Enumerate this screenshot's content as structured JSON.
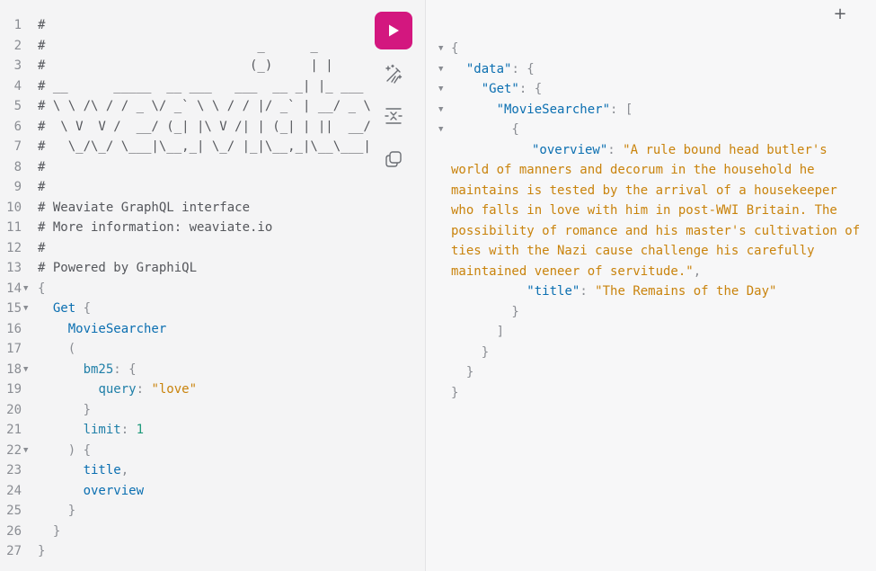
{
  "query_editor": {
    "lines": [
      {
        "n": "1",
        "fold": "",
        "parts": [
          {
            "t": "#",
            "c": "c-comment"
          }
        ]
      },
      {
        "n": "2",
        "fold": "",
        "parts": [
          {
            "t": "#                            _      _",
            "c": "c-comment"
          }
        ]
      },
      {
        "n": "3",
        "fold": "",
        "parts": [
          {
            "t": "#                           (_)     | |",
            "c": "c-comment"
          }
        ]
      },
      {
        "n": "4",
        "fold": "",
        "parts": [
          {
            "t": "# __      _____  __ ___   ___  __ _| |_ ___",
            "c": "c-comment"
          }
        ]
      },
      {
        "n": "5",
        "fold": "",
        "parts": [
          {
            "t": "# \\ \\ /\\ / / _ \\/ _` \\ \\ / / |/ _` | __/ _ \\",
            "c": "c-comment"
          }
        ]
      },
      {
        "n": "6",
        "fold": "",
        "parts": [
          {
            "t": "#  \\ V  V /  __/ (_| |\\ V /| | (_| | ||  __/",
            "c": "c-comment"
          }
        ]
      },
      {
        "n": "7",
        "fold": "",
        "parts": [
          {
            "t": "#   \\_/\\_/ \\___|\\__,_| \\_/ |_|\\__,_|\\__\\___|",
            "c": "c-comment"
          }
        ]
      },
      {
        "n": "8",
        "fold": "",
        "parts": [
          {
            "t": "#",
            "c": "c-comment"
          }
        ]
      },
      {
        "n": "9",
        "fold": "",
        "parts": [
          {
            "t": "#",
            "c": "c-comment"
          }
        ]
      },
      {
        "n": "10",
        "fold": "",
        "parts": [
          {
            "t": "# Weaviate GraphQL interface",
            "c": "c-comment"
          }
        ]
      },
      {
        "n": "11",
        "fold": "",
        "parts": [
          {
            "t": "# More information: weaviate.io",
            "c": "c-comment"
          }
        ]
      },
      {
        "n": "12",
        "fold": "",
        "parts": [
          {
            "t": "#",
            "c": "c-comment"
          }
        ]
      },
      {
        "n": "13",
        "fold": "",
        "parts": [
          {
            "t": "# Powered by GraphiQL",
            "c": "c-comment"
          }
        ]
      },
      {
        "n": "14",
        "fold": "▼",
        "parts": [
          {
            "t": "{",
            "c": "c-punc"
          }
        ]
      },
      {
        "n": "15",
        "fold": "▼",
        "parts": [
          {
            "t": "  ",
            "c": ""
          },
          {
            "t": "Get",
            "c": "c-kw"
          },
          {
            "t": " {",
            "c": "c-punc"
          }
        ]
      },
      {
        "n": "16",
        "fold": "",
        "parts": [
          {
            "t": "    ",
            "c": ""
          },
          {
            "t": "MovieSearcher",
            "c": "c-field"
          }
        ]
      },
      {
        "n": "17",
        "fold": "",
        "parts": [
          {
            "t": "    (",
            "c": "c-punc"
          }
        ]
      },
      {
        "n": "18",
        "fold": "▼",
        "parts": [
          {
            "t": "      ",
            "c": ""
          },
          {
            "t": "bm25",
            "c": "c-arg"
          },
          {
            "t": ": {",
            "c": "c-punc"
          }
        ]
      },
      {
        "n": "19",
        "fold": "",
        "parts": [
          {
            "t": "        ",
            "c": ""
          },
          {
            "t": "query",
            "c": "c-arg"
          },
          {
            "t": ": ",
            "c": "c-punc"
          },
          {
            "t": "\"love\"",
            "c": "c-str"
          }
        ]
      },
      {
        "n": "20",
        "fold": "",
        "parts": [
          {
            "t": "      }",
            "c": "c-punc"
          }
        ]
      },
      {
        "n": "21",
        "fold": "",
        "parts": [
          {
            "t": "      ",
            "c": ""
          },
          {
            "t": "limit",
            "c": "c-arg"
          },
          {
            "t": ": ",
            "c": "c-punc"
          },
          {
            "t": "1",
            "c": "c-num"
          }
        ]
      },
      {
        "n": "22",
        "fold": "▼",
        "parts": [
          {
            "t": "    ) {",
            "c": "c-punc"
          }
        ]
      },
      {
        "n": "23",
        "fold": "",
        "parts": [
          {
            "t": "      ",
            "c": ""
          },
          {
            "t": "title",
            "c": "c-field"
          },
          {
            "t": ",",
            "c": "c-punc"
          }
        ]
      },
      {
        "n": "24",
        "fold": "",
        "parts": [
          {
            "t": "      ",
            "c": ""
          },
          {
            "t": "overview",
            "c": "c-field"
          }
        ]
      },
      {
        "n": "25",
        "fold": "",
        "parts": [
          {
            "t": "    }",
            "c": "c-punc"
          }
        ]
      },
      {
        "n": "26",
        "fold": "",
        "parts": [
          {
            "t": "  }",
            "c": "c-punc"
          }
        ]
      },
      {
        "n": "27",
        "fold": "",
        "parts": [
          {
            "t": "}",
            "c": "c-punc"
          }
        ]
      }
    ]
  },
  "toolbar": {
    "run_icon": "play-icon",
    "prettify_icon": "magic-wand-icon",
    "merge_icon": "merge-fragments-icon",
    "copy_icon": "copy-icon"
  },
  "results_header": {
    "add_tab": "+"
  },
  "result_viewer": {
    "lines_before": [
      {
        "fold": "▼",
        "parts": [
          {
            "t": "{",
            "c": "r-punc"
          }
        ]
      },
      {
        "fold": "▼",
        "parts": [
          {
            "t": "  ",
            "c": ""
          },
          {
            "t": "\"data\"",
            "c": "r-key"
          },
          {
            "t": ": {",
            "c": "r-punc"
          }
        ]
      },
      {
        "fold": "▼",
        "parts": [
          {
            "t": "    ",
            "c": ""
          },
          {
            "t": "\"Get\"",
            "c": "r-key"
          },
          {
            "t": ": {",
            "c": "r-punc"
          }
        ]
      },
      {
        "fold": "▼",
        "parts": [
          {
            "t": "      ",
            "c": ""
          },
          {
            "t": "\"MovieSearcher\"",
            "c": "r-key"
          },
          {
            "t": ": [",
            "c": "r-punc"
          }
        ]
      },
      {
        "fold": "▼",
        "parts": [
          {
            "t": "        {",
            "c": "r-punc"
          }
        ]
      }
    ],
    "overview_key": "\"overview\"",
    "overview_value": "\"A rule bound head butler's world of manners and decorum in the household he maintains is tested by the arrival of a housekeeper who falls in love with him in post-WWI Britain. The possibility of romance and his master's cultivation of ties with the Nazi cause challenge his carefully maintained veneer of servitude.\"",
    "lines_after": [
      {
        "fold": "",
        "parts": [
          {
            "t": "          ",
            "c": ""
          },
          {
            "t": "\"title\"",
            "c": "r-key"
          },
          {
            "t": ": ",
            "c": "r-punc"
          },
          {
            "t": "\"The Remains of the Day\"",
            "c": "r-str"
          }
        ]
      },
      {
        "fold": "",
        "parts": [
          {
            "t": "        }",
            "c": "r-punc"
          }
        ]
      },
      {
        "fold": "",
        "parts": [
          {
            "t": "      ]",
            "c": "r-punc"
          }
        ]
      },
      {
        "fold": "",
        "parts": [
          {
            "t": "    }",
            "c": "r-punc"
          }
        ]
      },
      {
        "fold": "",
        "parts": [
          {
            "t": "  }",
            "c": "r-punc"
          }
        ]
      },
      {
        "fold": "",
        "parts": [
          {
            "t": "}",
            "c": "r-punc"
          }
        ]
      }
    ]
  },
  "colors": {
    "run_button": "#d3177f",
    "keyword": "#0b6fb1",
    "string": "#c9830c",
    "number": "#1e9a7b"
  }
}
